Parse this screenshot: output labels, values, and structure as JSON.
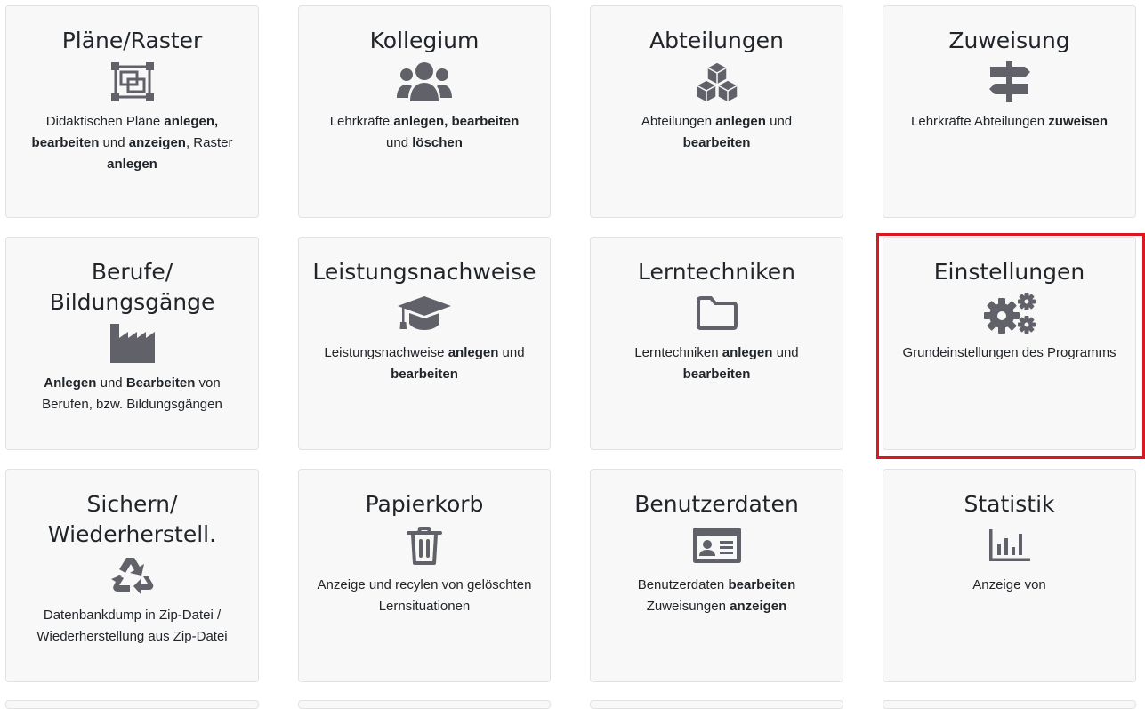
{
  "colors": {
    "icon": "#616169",
    "highlight": "#d9191f",
    "card_bg": "#f8f8f8"
  },
  "cards": [
    {
      "title": "Pläne/Raster",
      "icon": "vector-square-icon",
      "desc": [
        [
          "Didaktischen Pläne ",
          "anlegen,"
        ],
        [
          " bearbeiten",
          " und "
        ],
        [
          "anzeigen",
          ", Raster "
        ],
        [
          "anlegen",
          ""
        ]
      ]
    },
    {
      "title": "Kollegium",
      "icon": "users-icon",
      "desc_parts": [
        "Lehrkräfte ",
        "anlegen, bearbeiten",
        " und ",
        "löschen"
      ]
    },
    {
      "title": "Abteilungen",
      "icon": "cubes-icon",
      "desc_parts": [
        "Abteilungen ",
        "anlegen",
        " und ",
        "bearbeiten"
      ]
    },
    {
      "title": "Zuweisung",
      "icon": "signs-post-icon",
      "desc_parts": [
        "Lehrkräfte Abteilungen ",
        "zuweisen"
      ]
    },
    {
      "title_line1": "Berufe/",
      "title_line2": "Bildungsgänge",
      "icon": "industry-icon",
      "desc_parts": [
        "Anlegen",
        " und ",
        "Bearbeiten",
        " von Berufen, bzw. Bildungsgängen"
      ]
    },
    {
      "title": "Leistungsnachweise",
      "icon": "graduation-cap-icon",
      "desc_parts": [
        "Leistungsnachweise ",
        "anlegen",
        " und ",
        "bearbeiten"
      ]
    },
    {
      "title": "Lerntechniken",
      "icon": "folder-icon",
      "desc_parts": [
        "Lerntechniken ",
        "anlegen",
        " und ",
        "bearbeiten"
      ]
    },
    {
      "title": "Einstellungen",
      "icon": "cogs-icon",
      "desc_parts": [
        "Grundeinstellungen des Programms"
      ]
    },
    {
      "title_line1": "Sichern/",
      "title_line2": "Wiederherstell.",
      "icon": "recycle-icon",
      "desc_parts": [
        "Datenbankdump in Zip-Datei / Wiederherstellung aus Zip-Datei"
      ]
    },
    {
      "title": "Papierkorb",
      "icon": "trash-icon",
      "desc_parts": [
        "Anzeige und recylen von gelöschten Lernsituationen"
      ]
    },
    {
      "title": "Benutzerdaten",
      "icon": "id-card-icon",
      "desc_parts": [
        "Benutzerdaten ",
        "bearbeiten",
        " Zuweisungen ",
        "anzeigen"
      ]
    },
    {
      "title": "Statistik",
      "icon": "chart-column-icon",
      "desc_parts": [
        "Anzeige von"
      ]
    }
  ]
}
